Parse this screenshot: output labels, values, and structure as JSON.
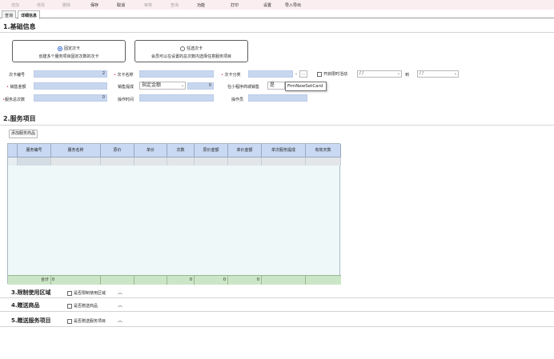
{
  "toolbar": {
    "items": [
      {
        "label": "增加",
        "enabled": false
      },
      {
        "label": "修改",
        "enabled": false
      },
      {
        "label": "删除",
        "enabled": false
      },
      {
        "label": "保存",
        "enabled": true
      },
      {
        "label": "取消",
        "enabled": true
      },
      {
        "label": "审核",
        "enabled": false
      },
      {
        "label": "查询",
        "enabled": false
      },
      {
        "label": "功能",
        "enabled": true
      },
      {
        "label": "打印",
        "enabled": true
      },
      {
        "label": "设置",
        "enabled": true
      },
      {
        "label": "导入导出",
        "enabled": true
      }
    ]
  },
  "tabs": [
    {
      "label": "查询",
      "active": false
    },
    {
      "label": "详细信息",
      "active": true
    }
  ],
  "basic": {
    "title": "1.基础信息",
    "card_types": [
      {
        "label": "固定次卡",
        "desc": "创建多个服务项目固定次数的次卡",
        "selected": true
      },
      {
        "label": "任选次卡",
        "desc": "会员可以在设置的总次数内选择任意服务项目",
        "selected": false
      }
    ],
    "fields": {
      "card_no": {
        "label": "次卡编号",
        "value": "2",
        "required": false
      },
      "card_name": {
        "label": "次卡名称",
        "value": "",
        "required": true
      },
      "card_category": {
        "label": "次卡分类",
        "value": "",
        "required": true
      },
      "limited_activity": {
        "label": "开启限时活动",
        "checked": false,
        "from": "/   /",
        "to_label": "到",
        "to": "/   /"
      },
      "sale_amount": {
        "label": "销售金额",
        "value": "",
        "required": true
      },
      "sale_commission": {
        "label": "销售提成",
        "mode": "指定金额",
        "value": "0",
        "required": false
      },
      "mini_program": {
        "label": "在小程序商城销售",
        "value": "是"
      },
      "total_times": {
        "label": "服务总次数",
        "value": "0",
        "required": true
      },
      "operate_time": {
        "label": "操作时间",
        "value": ""
      },
      "operator": {
        "label": "操作员",
        "value": ""
      }
    },
    "tooltip": "FrmNewSetCard"
  },
  "service": {
    "title": "2.服务项目",
    "add_button": "添加服务商品",
    "columns": [
      "服务编号",
      "服务名称",
      "原价",
      "单价",
      "次数",
      "原价金额",
      "单价金额",
      "单次服务提成",
      "有效天数"
    ],
    "footer": {
      "label": "合计",
      "first_value": "0",
      "times": "0",
      "orig_amount": "0",
      "unit_amount": "0"
    }
  },
  "sections": [
    {
      "title": "3.限制使用区域",
      "option": "是否限制使用区域",
      "checked": false
    },
    {
      "title": "4.赠送商品",
      "option": "是否赠送商品",
      "checked": false
    },
    {
      "title": "5.赠送服务项目",
      "option": "是否赠送服务项目",
      "checked": false
    }
  ]
}
